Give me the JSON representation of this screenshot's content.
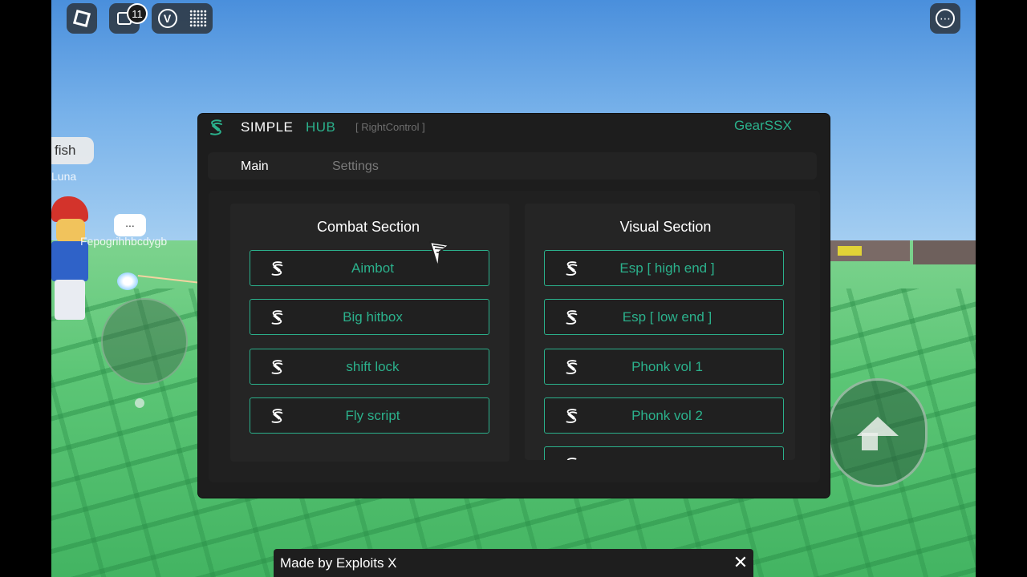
{
  "hub": {
    "title_main": "SIMPLE",
    "title_accent": "HUB",
    "keybind": "[ RightControl ]",
    "user": "GearSSX",
    "accent_color": "#2bb18c",
    "logo_icon": "s-logo-icon",
    "tabs": [
      {
        "label": "Main",
        "active": true
      },
      {
        "label": "Settings",
        "active": false
      }
    ],
    "sections": {
      "combat": {
        "title": "Combat Section",
        "buttons": [
          "Aimbot",
          "Big hitbox",
          "shift lock",
          "Fly script"
        ]
      },
      "visual": {
        "title": "Visual Section",
        "buttons": [
          "Esp [ high end ]",
          "Esp [ low end ]",
          "Phonk vol 1",
          "Phonk vol 2",
          ""
        ]
      }
    }
  },
  "notification": {
    "text": "Made by Exploits X",
    "close_glyph": "✕"
  },
  "game": {
    "chat_bubble_text": "fish",
    "nearby_player_name": "Luna",
    "player_name": "Fepogrihhbcdygb",
    "typing_indicator": "...",
    "chat_unread_count": "11",
    "voice_label": "V"
  }
}
